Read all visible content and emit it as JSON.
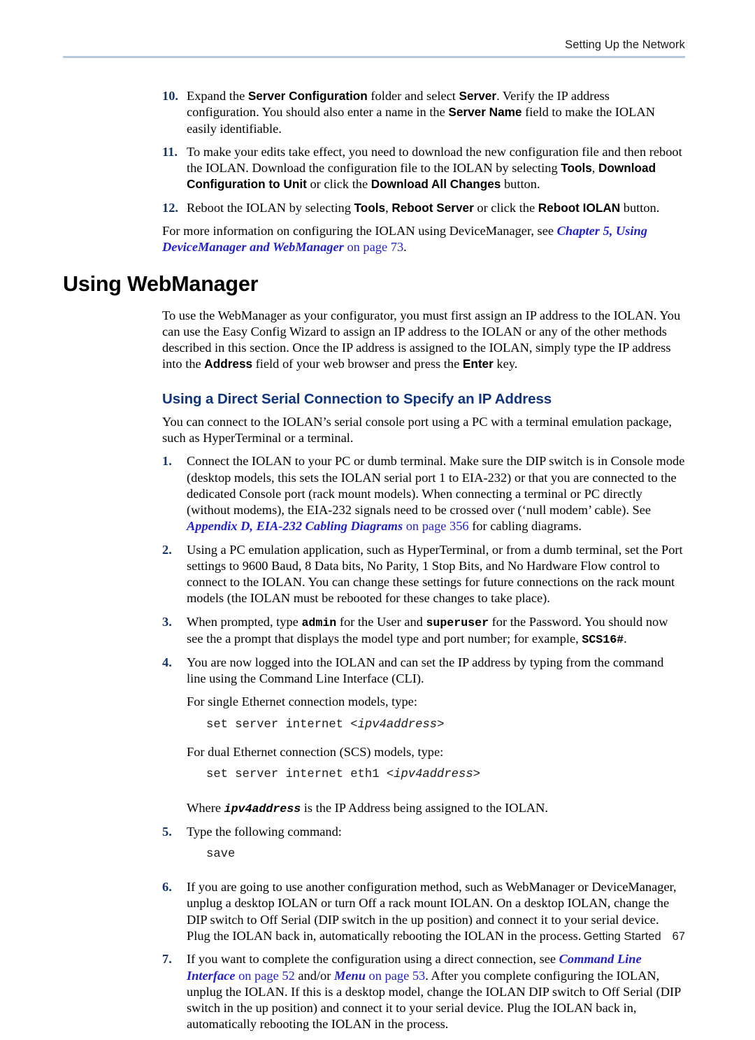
{
  "header": {
    "running_head": "Setting Up the Network"
  },
  "footer": {
    "label": "Getting Started",
    "page_number": "67"
  },
  "colors": {
    "rule": "#b9c9dd",
    "list_number": "#16356e",
    "subheading": "#10357e",
    "crossref": "#2222cc",
    "body_text": "#000000"
  },
  "steps_top": [
    {
      "number": "10.",
      "parts": [
        {
          "t": "Expand the ",
          "s": "plain"
        },
        {
          "t": "Server Configuration",
          "s": "ui"
        },
        {
          "t": " folder and select ",
          "s": "plain"
        },
        {
          "t": "Server",
          "s": "ui"
        },
        {
          "t": ". Verify the IP address configuration. You should also enter a name in the ",
          "s": "plain"
        },
        {
          "t": "Server Name",
          "s": "ui"
        },
        {
          "t": " field to make the IOLAN easily identifiable.",
          "s": "plain"
        }
      ]
    },
    {
      "number": "11.",
      "parts": [
        {
          "t": "To make your edits take effect, you need to download the new configuration file and then reboot the IOLAN. Download the configuration file to the IOLAN by selecting ",
          "s": "plain"
        },
        {
          "t": "Tools",
          "s": "ui"
        },
        {
          "t": ", ",
          "s": "plain"
        },
        {
          "t": "Download Configuration to Unit",
          "s": "ui"
        },
        {
          "t": " or click the ",
          "s": "plain"
        },
        {
          "t": "Download All Changes",
          "s": "ui"
        },
        {
          "t": " button.",
          "s": "plain"
        }
      ]
    },
    {
      "number": "12.",
      "parts": [
        {
          "t": "Reboot the IOLAN by selecting ",
          "s": "plain"
        },
        {
          "t": "Tools",
          "s": "ui"
        },
        {
          "t": ", ",
          "s": "plain"
        },
        {
          "t": "Reboot Server",
          "s": "ui"
        },
        {
          "t": " or click the ",
          "s": "plain"
        },
        {
          "t": "Reboot IOLAN",
          "s": "ui"
        },
        {
          "t": " button.",
          "s": "plain"
        }
      ]
    }
  ],
  "intro_paragraph": {
    "parts": [
      {
        "t": "For more information on configuring the IOLAN using DeviceManager, see ",
        "s": "plain"
      },
      {
        "t": "Chapter 5, Using DeviceManager and WebManager",
        "s": "xref"
      },
      {
        "t": " on page 73",
        "s": "xpage"
      },
      {
        "t": ".",
        "s": "plain"
      }
    ]
  },
  "section_heading": "Using WebManager",
  "section_intro": {
    "parts": [
      {
        "t": "To use the WebManager as your configurator, you must first assign an IP address to the IOLAN. You can use the Easy Config Wizard to assign an IP address to the IOLAN or any of the other methods described in this section. Once the IP address is assigned to the IOLAN, simply type the IP address into the ",
        "s": "plain"
      },
      {
        "t": "Address",
        "s": "ui"
      },
      {
        "t": " field of your web browser and press the ",
        "s": "plain"
      },
      {
        "t": "Enter",
        "s": "ui"
      },
      {
        "t": " key.",
        "s": "plain"
      }
    ]
  },
  "subsection_heading": "Using a Direct Serial Connection to Specify an IP Address",
  "subsection_intro": {
    "parts": [
      {
        "t": "You can connect to the IOLAN’s serial console port using a PC with a terminal emulation package, such as HyperTerminal or a terminal.",
        "s": "plain"
      }
    ]
  },
  "steps_main": [
    {
      "number": "1.",
      "parts": [
        {
          "t": "Connect the IOLAN to your PC or dumb terminal. Make sure the DIP switch is in Console mode (desktop models, this sets the IOLAN serial port 1 to EIA-232) or that you are connected to the dedicated Console port (rack mount models). When connecting a terminal or PC directly (without modems), the EIA-232 signals need to be crossed over (‘null modem’ cable). See ",
          "s": "plain"
        },
        {
          "t": "Appendix D, EIA-232 Cabling Diagrams",
          "s": "xref"
        },
        {
          "t": " on page 356",
          "s": "xpage"
        },
        {
          "t": " for cabling diagrams.",
          "s": "plain"
        }
      ]
    },
    {
      "number": "2.",
      "parts": [
        {
          "t": "Using a PC emulation application, such as HyperTerminal, or from a dumb terminal, set the Port settings to 9600 Baud, 8 Data bits, No Parity, 1 Stop Bits, and No Hardware Flow control to connect to the IOLAN. You can change these settings for future connections on the rack mount models (the IOLAN must be rebooted for these changes to take place).",
          "s": "plain"
        }
      ]
    },
    {
      "number": "3.",
      "parts": [
        {
          "t": "When prompted, type ",
          "s": "plain"
        },
        {
          "t": "admin",
          "s": "mono"
        },
        {
          "t": " for the User and ",
          "s": "plain"
        },
        {
          "t": "superuser",
          "s": "mono"
        },
        {
          "t": " for the Password. You should now see the a prompt that displays the model type and port number; for example, ",
          "s": "plain"
        },
        {
          "t": "SCS16#",
          "s": "mono"
        },
        {
          "t": ".",
          "s": "plain"
        }
      ]
    },
    {
      "number": "4.",
      "parts": [
        {
          "t": "You are now logged into the IOLAN and can set the IP address by typing from the command line using the Command Line Interface (CLI).",
          "s": "plain"
        }
      ]
    }
  ],
  "after_step4": {
    "line_single": "For single Ethernet connection models, type:",
    "code_single": [
      {
        "t": "set server internet ",
        "s": "plain"
      },
      {
        "t": "<ipv4address>",
        "s": "italic"
      }
    ],
    "line_dual": "For dual Ethernet connection (SCS) models, type:",
    "code_dual": [
      {
        "t": "set server internet eth1 ",
        "s": "plain"
      },
      {
        "t": "<ipv4address>",
        "s": "italic"
      }
    ],
    "where_line": [
      {
        "t": "Where ",
        "s": "plain"
      },
      {
        "t": "ipv4address",
        "s": "monobi"
      },
      {
        "t": " is the IP Address being assigned to the IOLAN.",
        "s": "plain"
      }
    ]
  },
  "step5": {
    "number": "5.",
    "parts": [
      {
        "t": "Type the following command:",
        "s": "plain"
      }
    ],
    "code": [
      {
        "t": "save",
        "s": "plain"
      }
    ]
  },
  "steps_tail": [
    {
      "number": "6.",
      "parts": [
        {
          "t": "If you are going to use another configuration method, such as WebManager or DeviceManager, unplug a desktop IOLAN or turn Off a rack mount IOLAN. On a desktop IOLAN, change the DIP switch to Off Serial (DIP switch in the up position) and connect it to your serial device. Plug the IOLAN back in, automatically rebooting the IOLAN in the process.",
          "s": "plain"
        }
      ]
    },
    {
      "number": "7.",
      "parts": [
        {
          "t": "If you want to complete the configuration using a direct connection, see ",
          "s": "plain"
        },
        {
          "t": "Command Line Interface",
          "s": "xref"
        },
        {
          "t": " on page 52",
          "s": "xpage"
        },
        {
          "t": " and/or ",
          "s": "plain"
        },
        {
          "t": "Menu",
          "s": "xref"
        },
        {
          "t": " on page 53",
          "s": "xpage"
        },
        {
          "t": ". After you complete configuring the IOLAN, unplug the IOLAN. If this is a desktop model, change the IOLAN DIP switch to Off Serial (DIP switch in the up position) and connect it to your serial device. Plug the IOLAN back in, automatically rebooting the IOLAN in the process.",
          "s": "plain"
        }
      ]
    }
  ]
}
